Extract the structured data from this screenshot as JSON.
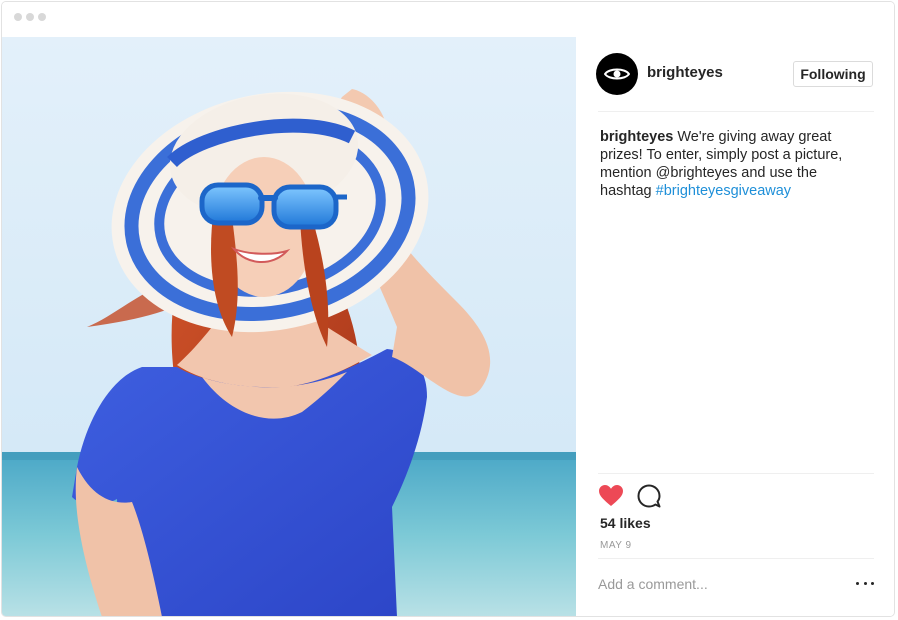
{
  "post": {
    "username": "brighteyes",
    "follow_label": "Following",
    "caption": {
      "user": "brighteyes",
      "text": " We're giving away great prizes! To enter, simply post a picture, mention @brighteyes and use the hashtag ",
      "hashtag": "#brighteyesgiveaway"
    },
    "likes": "54 likes",
    "date": "MAY 9",
    "comment_placeholder": "Add a comment...",
    "liked": true
  },
  "icons": {
    "avatar": "eye-icon",
    "like": "heart-icon",
    "comment": "comment-icon",
    "more": "more-dots-icon"
  },
  "colors": {
    "heart": "#ed4956",
    "hashtag": "#1e8fd8",
    "follow_border": "#dbdbdb"
  }
}
